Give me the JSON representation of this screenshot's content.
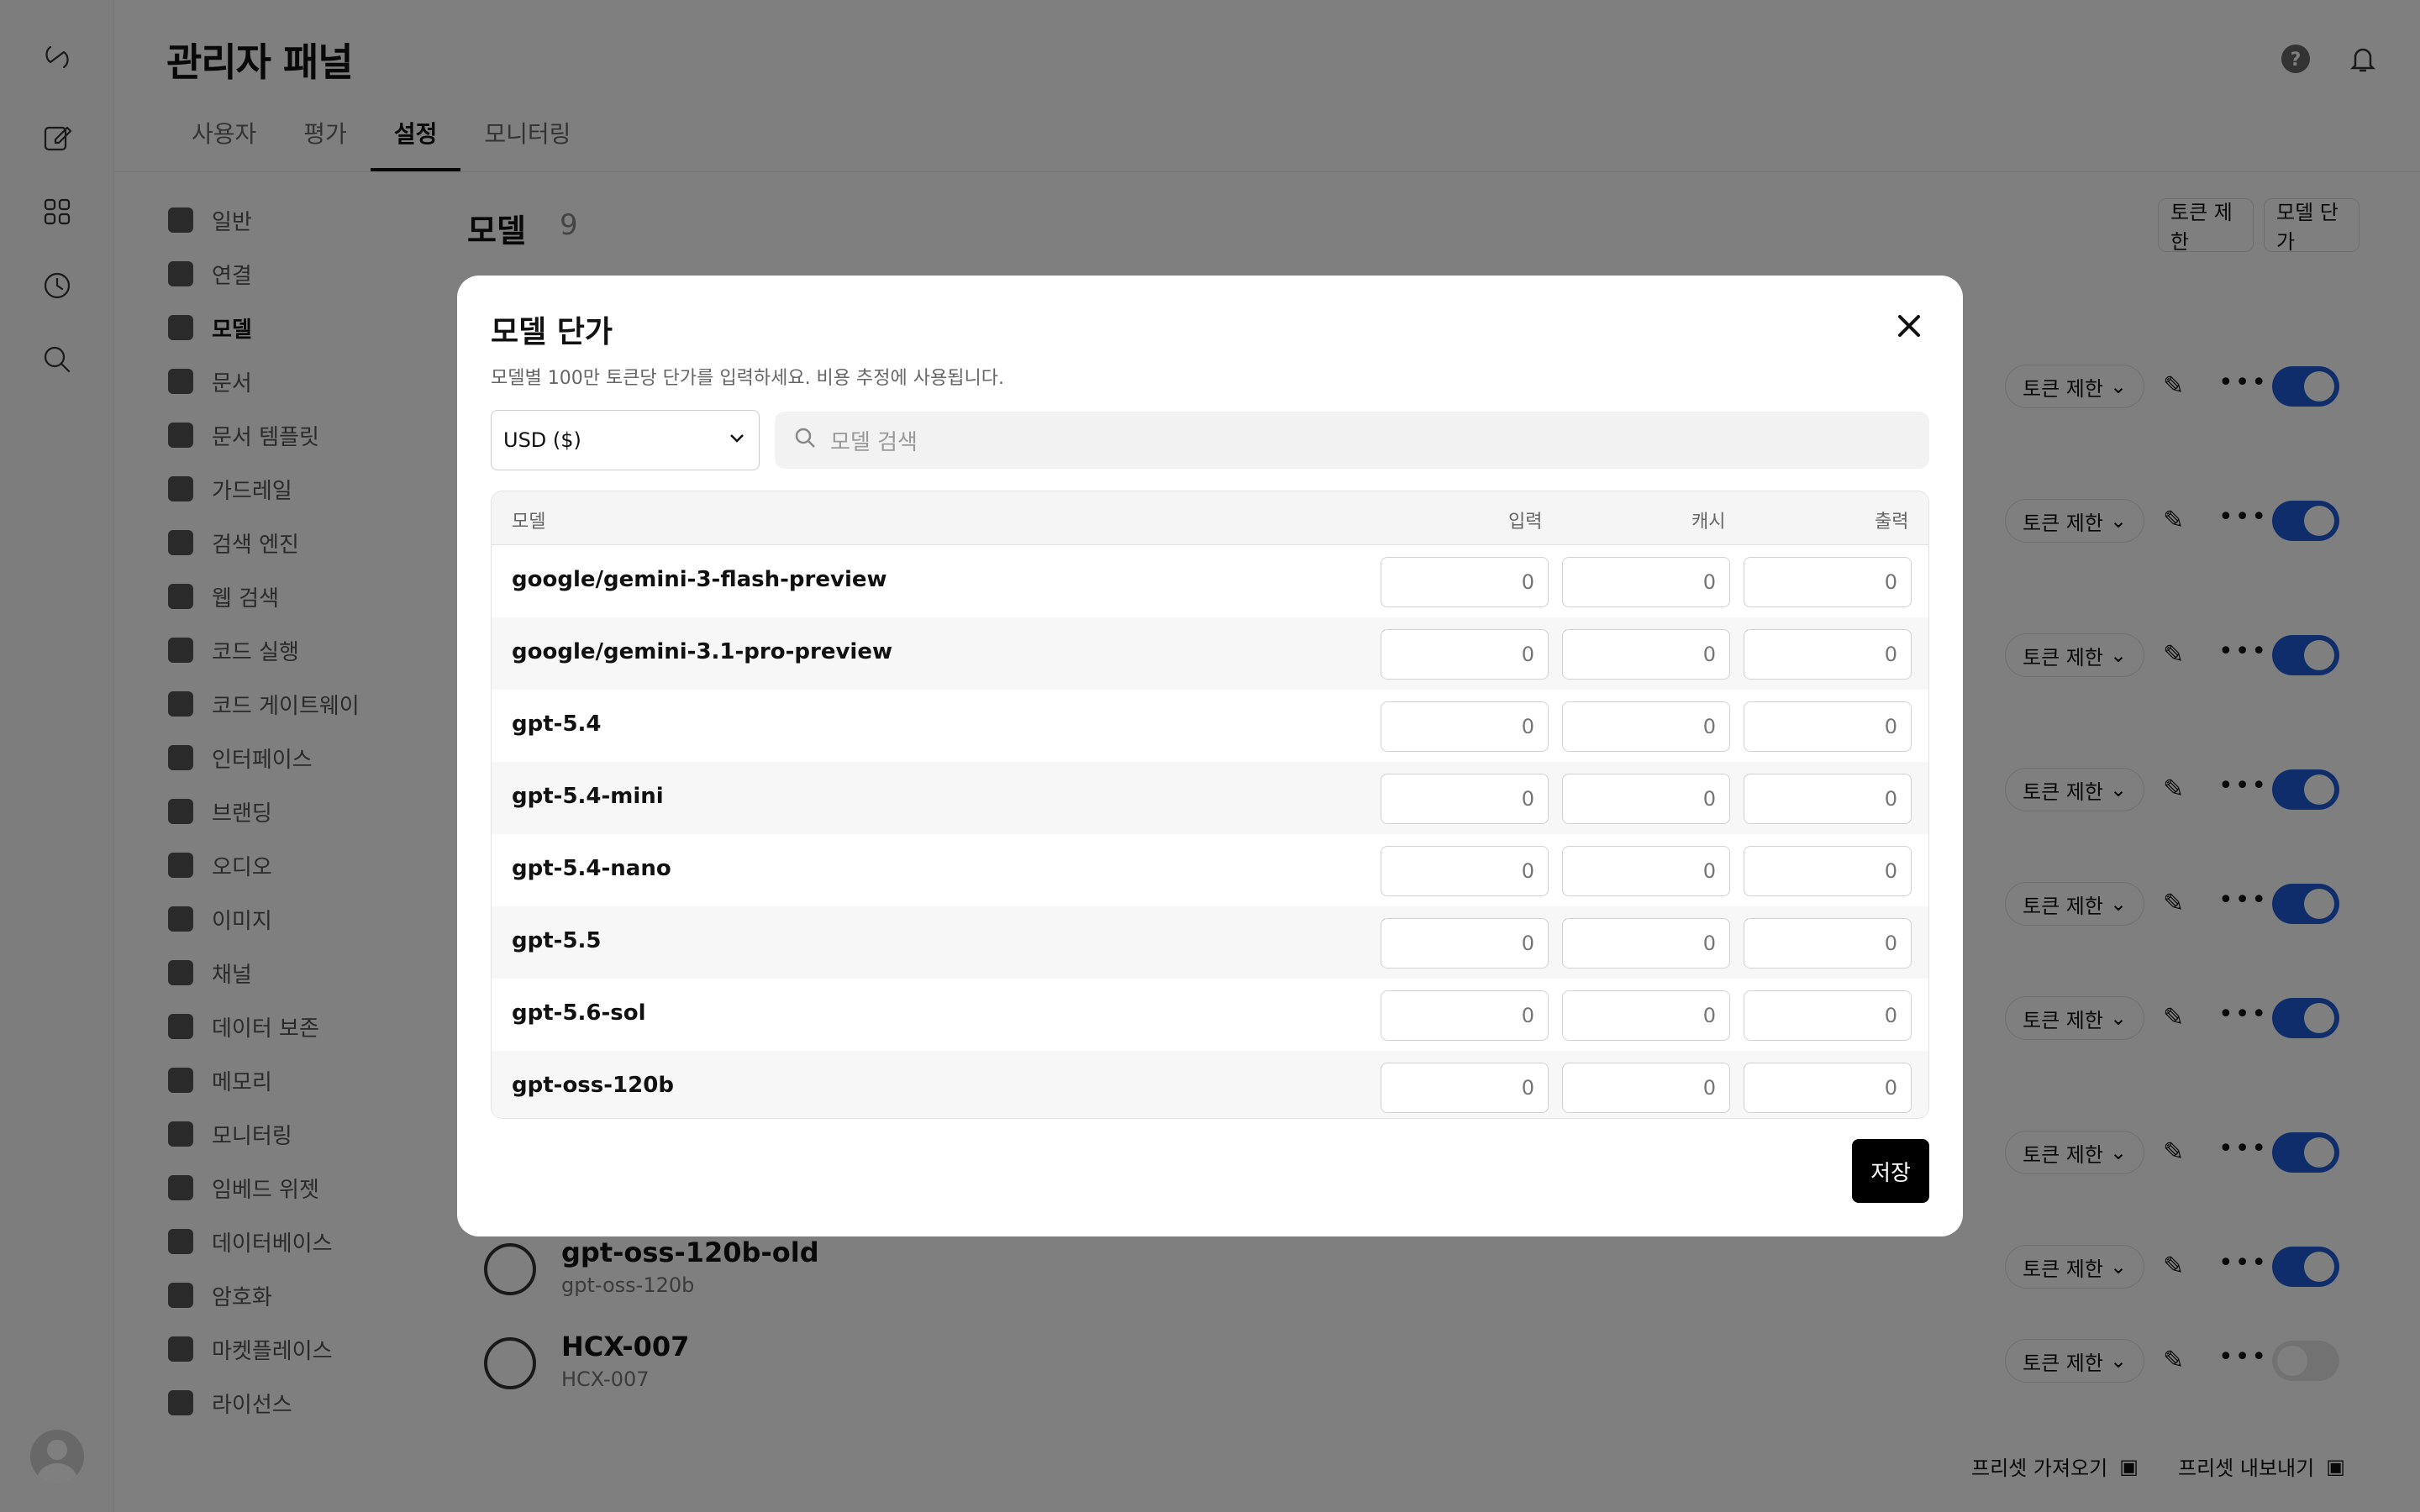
{
  "page": {
    "title": "관리자 패널"
  },
  "tabs": [
    "사용자",
    "평가",
    "설정",
    "모니터링"
  ],
  "active_tab": "설정",
  "settings_nav": [
    {
      "label": "일반",
      "icon": "gear-icon"
    },
    {
      "label": "연결",
      "icon": "cloud-icon"
    },
    {
      "label": "모델",
      "icon": "database-icon"
    },
    {
      "label": "문서",
      "icon": "document-icon"
    },
    {
      "label": "문서 템플릿",
      "icon": "document-template-icon"
    },
    {
      "label": "가드레일",
      "icon": "shield-icon"
    },
    {
      "label": "검색 엔진",
      "icon": "grid-icon"
    },
    {
      "label": "웹 검색",
      "icon": "globe-icon"
    },
    {
      "label": "코드 실행",
      "icon": "terminal-icon"
    },
    {
      "label": "코드 게이트웨이",
      "icon": "code-icon"
    },
    {
      "label": "인터페이스",
      "icon": "monitor-icon"
    },
    {
      "label": "브랜딩",
      "icon": "pencil-square-icon"
    },
    {
      "label": "오디오",
      "icon": "speaker-icon"
    },
    {
      "label": "이미지",
      "icon": "image-icon"
    },
    {
      "label": "채널",
      "icon": "channel-icon"
    },
    {
      "label": "데이터 보존",
      "icon": "clock-icon"
    },
    {
      "label": "메모리",
      "icon": "memory-icon"
    },
    {
      "label": "모니터링",
      "icon": "chart-icon"
    },
    {
      "label": "임베드 위젯",
      "icon": "code-icon"
    },
    {
      "label": "데이터베이스",
      "icon": "database-icon"
    },
    {
      "label": "암호화",
      "icon": "lock-icon"
    },
    {
      "label": "마켓플레이스",
      "icon": "store-icon"
    },
    {
      "label": "라이선스",
      "icon": "key-icon"
    }
  ],
  "active_nav": "모델",
  "models_header": {
    "title": "모델",
    "count": "9",
    "token_limit_btn": "토큰 제한",
    "model_price_btn": "모델 단가"
  },
  "model_rows": [
    {
      "name": "",
      "sub": "",
      "limit": "토큰 제한",
      "enabled": true
    },
    {
      "name": "",
      "sub": "",
      "limit": "토큰 제한",
      "enabled": true
    },
    {
      "name": "",
      "sub": "",
      "limit": "토큰 제한",
      "enabled": true
    },
    {
      "name": "",
      "sub": "",
      "limit": "토큰 제한",
      "enabled": true
    },
    {
      "name": "",
      "sub": "",
      "limit": "토큰 제한",
      "enabled": true
    },
    {
      "name": "",
      "sub": "",
      "limit": "토큰 제한",
      "enabled": true
    },
    {
      "name": "",
      "sub": "",
      "limit": "토큰 제한",
      "enabled": true
    },
    {
      "name": "gpt-oss-120b-old",
      "sub": "gpt-oss-120b",
      "limit": "토큰 제한",
      "enabled": true
    },
    {
      "name": "HCX-007",
      "sub": "HCX-007",
      "limit": "토큰 제한",
      "enabled": false
    }
  ],
  "footer": {
    "import": "프리셋 가져오기",
    "export": "프리셋 내보내기"
  },
  "modal": {
    "title": "모델 단가",
    "description": "모델별 100만 토큰당 단가를 입력하세요. 비용 추정에 사용됩니다.",
    "currency": "USD ($)",
    "search_placeholder": "모델 검색",
    "columns": {
      "model": "모델",
      "input": "입력",
      "cache": "캐시",
      "output": "출력"
    },
    "rows": [
      {
        "model": "google/gemini-3-flash-preview",
        "input": "0",
        "cache": "0",
        "output": "0"
      },
      {
        "model": "google/gemini-3.1-pro-preview",
        "input": "0",
        "cache": "0",
        "output": "0"
      },
      {
        "model": "gpt-5.4",
        "input": "0",
        "cache": "0",
        "output": "0"
      },
      {
        "model": "gpt-5.4-mini",
        "input": "0",
        "cache": "0",
        "output": "0"
      },
      {
        "model": "gpt-5.4-nano",
        "input": "0",
        "cache": "0",
        "output": "0"
      },
      {
        "model": "gpt-5.5",
        "input": "0",
        "cache": "0",
        "output": "0"
      },
      {
        "model": "gpt-5.6-sol",
        "input": "0",
        "cache": "0",
        "output": "0"
      },
      {
        "model": "gpt-oss-120b",
        "input": "0",
        "cache": "0",
        "output": "0"
      }
    ],
    "save_label": "저장"
  },
  "colors": {
    "accent": "#1e5bd6",
    "overlay": "#808080",
    "save_bg": "#000000"
  }
}
